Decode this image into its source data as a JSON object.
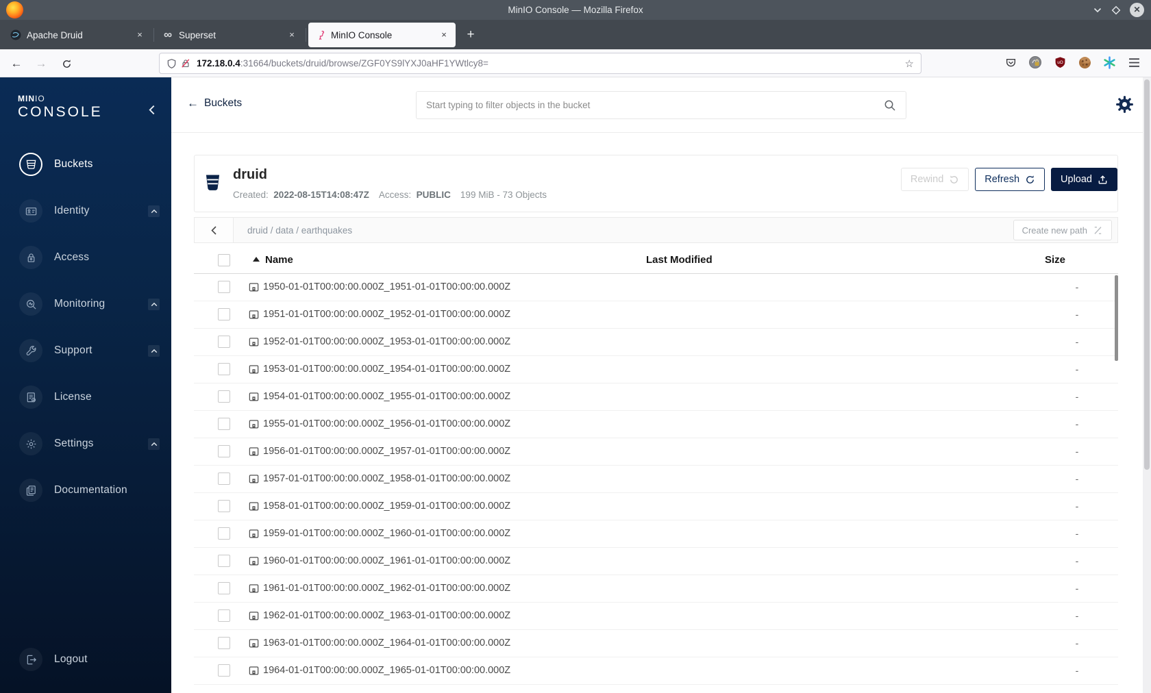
{
  "window": {
    "title": "MinIO Console — Mozilla Firefox"
  },
  "browser": {
    "tabs": [
      {
        "label": "Apache Druid",
        "icon": "druid-favicon",
        "active": false
      },
      {
        "label": "Superset",
        "icon": "superset-favicon",
        "active": false
      },
      {
        "label": "MinIO Console",
        "icon": "minio-favicon",
        "active": true
      }
    ],
    "new_tab_label": "+",
    "url": {
      "host": "172.18.0.4",
      "rest": ":31664/buckets/druid/browse/ZGF0YS9lYXJ0aHF1YWtlcy8="
    }
  },
  "sidebar": {
    "logo_brand_bold": "MIN",
    "logo_brand_light": "IO",
    "logo_product": "CONSOLE",
    "items": [
      {
        "label": "Buckets",
        "icon": "bucket-icon",
        "active": true,
        "expandable": false
      },
      {
        "label": "Identity",
        "icon": "identity-icon",
        "active": false,
        "expandable": true
      },
      {
        "label": "Access",
        "icon": "access-icon",
        "active": false,
        "expandable": false
      },
      {
        "label": "Monitoring",
        "icon": "monitoring-icon",
        "active": false,
        "expandable": true
      },
      {
        "label": "Support",
        "icon": "support-icon",
        "active": false,
        "expandable": true
      },
      {
        "label": "License",
        "icon": "license-icon",
        "active": false,
        "expandable": false
      },
      {
        "label": "Settings",
        "icon": "settings-icon",
        "active": false,
        "expandable": true
      },
      {
        "label": "Documentation",
        "icon": "documentation-icon",
        "active": false,
        "expandable": false
      }
    ],
    "logout": {
      "label": "Logout",
      "icon": "logout-icon"
    }
  },
  "header": {
    "back_label": "Buckets",
    "search_placeholder": "Start typing to filter objects in the bucket"
  },
  "bucket": {
    "name": "druid",
    "created_label": "Created:",
    "created_value": "2022-08-15T14:08:47Z",
    "access_label": "Access:",
    "access_value": "PUBLIC",
    "usage": "199 MiB - 73 Objects",
    "buttons": {
      "rewind": "Rewind",
      "refresh": "Refresh",
      "upload": "Upload"
    }
  },
  "pathbar": {
    "breadcrumb": "druid / data / earthquakes",
    "create_button": "Create new path"
  },
  "objects": {
    "columns": {
      "name": "Name",
      "last_modified": "Last Modified",
      "size": "Size"
    },
    "size_placeholder": "-",
    "rows": [
      "1950-01-01T00:00:00.000Z_1951-01-01T00:00:00.000Z",
      "1951-01-01T00:00:00.000Z_1952-01-01T00:00:00.000Z",
      "1952-01-01T00:00:00.000Z_1953-01-01T00:00:00.000Z",
      "1953-01-01T00:00:00.000Z_1954-01-01T00:00:00.000Z",
      "1954-01-01T00:00:00.000Z_1955-01-01T00:00:00.000Z",
      "1955-01-01T00:00:00.000Z_1956-01-01T00:00:00.000Z",
      "1956-01-01T00:00:00.000Z_1957-01-01T00:00:00.000Z",
      "1957-01-01T00:00:00.000Z_1958-01-01T00:00:00.000Z",
      "1958-01-01T00:00:00.000Z_1959-01-01T00:00:00.000Z",
      "1959-01-01T00:00:00.000Z_1960-01-01T00:00:00.000Z",
      "1960-01-01T00:00:00.000Z_1961-01-01T00:00:00.000Z",
      "1961-01-01T00:00:00.000Z_1962-01-01T00:00:00.000Z",
      "1962-01-01T00:00:00.000Z_1963-01-01T00:00:00.000Z",
      "1963-01-01T00:00:00.000Z_1964-01-01T00:00:00.000Z",
      "1964-01-01T00:00:00.000Z_1965-01-01T00:00:00.000Z"
    ]
  },
  "colors": {
    "brand_navy": "#081C42",
    "sidebar_gradient_top": "#0a2b55",
    "sidebar_gradient_bottom": "#051226",
    "flamingo_pink": "#e2487e",
    "ublock_red": "#7d0d15"
  }
}
